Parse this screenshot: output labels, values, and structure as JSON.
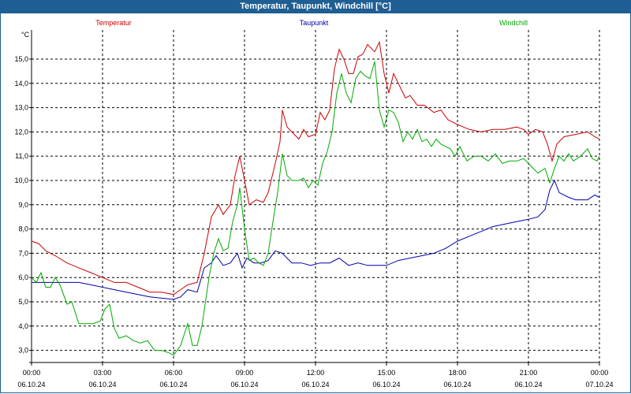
{
  "window": {
    "title": "Temperatur, Taupunkt, Windchill [°C]"
  },
  "chart_data": {
    "type": "line",
    "title": "Temperatur, Taupunkt, Windchill [°C]",
    "ylabel": "°C",
    "xlabel": "",
    "ylim": [
      2.5,
      16.2
    ],
    "xlim": [
      0,
      24
    ],
    "grid": true,
    "y_ticks": [
      "3,0",
      "4,0",
      "5,0",
      "6,0",
      "7,0",
      "8,0",
      "9,0",
      "10,0",
      "11,0",
      "12,0",
      "13,0",
      "14,0",
      "15,0"
    ],
    "y_tick_values": [
      3,
      4,
      5,
      6,
      7,
      8,
      9,
      10,
      11,
      12,
      13,
      14,
      15
    ],
    "x_tick_values": [
      0,
      3,
      6,
      9,
      12,
      15,
      18,
      21,
      24
    ],
    "x_ticks": [
      {
        "time": "00:00",
        "date": "06.10.24"
      },
      {
        "time": "03:00",
        "date": "06.10.24"
      },
      {
        "time": "06:00",
        "date": "06.10.24"
      },
      {
        "time": "09:00",
        "date": "06.10.24"
      },
      {
        "time": "12:00",
        "date": "06.10.24"
      },
      {
        "time": "15:00",
        "date": "06.10.24"
      },
      {
        "time": "18:00",
        "date": "06.10.24"
      },
      {
        "time": "21:00",
        "date": "06.10.24"
      },
      {
        "time": "00:00",
        "date": "07.10.24"
      }
    ],
    "legend": [
      {
        "name": "Temperatur",
        "color": "#cc0000"
      },
      {
        "name": "Taupunkt",
        "color": "#0000aa"
      },
      {
        "name": "Windchill",
        "color": "#00aa00"
      }
    ],
    "series": [
      {
        "name": "Temperatur",
        "color": "#cc0000",
        "points": [
          [
            0,
            7.5
          ],
          [
            0.3,
            7.4
          ],
          [
            0.6,
            7.1
          ],
          [
            1,
            6.9
          ],
          [
            1.5,
            6.6
          ],
          [
            2,
            6.4
          ],
          [
            2.5,
            6.2
          ],
          [
            3,
            6.0
          ],
          [
            3.5,
            5.8
          ],
          [
            4,
            5.8
          ],
          [
            4.5,
            5.6
          ],
          [
            5,
            5.4
          ],
          [
            5.5,
            5.4
          ],
          [
            6,
            5.3
          ],
          [
            6.3,
            5.5
          ],
          [
            6.6,
            5.7
          ],
          [
            7,
            5.8
          ],
          [
            7.3,
            7.0
          ],
          [
            7.6,
            8.5
          ],
          [
            7.9,
            9.0
          ],
          [
            8.1,
            8.6
          ],
          [
            8.4,
            9.0
          ],
          [
            8.6,
            10.2
          ],
          [
            8.8,
            11.0
          ],
          [
            9,
            10.0
          ],
          [
            9.2,
            9.0
          ],
          [
            9.5,
            9.2
          ],
          [
            9.8,
            9.1
          ],
          [
            10,
            9.5
          ],
          [
            10.3,
            10.7
          ],
          [
            10.5,
            11.6
          ],
          [
            10.6,
            12.9
          ],
          [
            10.8,
            12.2
          ],
          [
            11.1,
            11.9
          ],
          [
            11.3,
            11.7
          ],
          [
            11.5,
            12.1
          ],
          [
            11.7,
            11.8
          ],
          [
            12,
            11.9
          ],
          [
            12.2,
            12.8
          ],
          [
            12.4,
            12.5
          ],
          [
            12.6,
            12.9
          ],
          [
            12.8,
            14.6
          ],
          [
            13,
            15.4
          ],
          [
            13.2,
            15.0
          ],
          [
            13.4,
            14.4
          ],
          [
            13.6,
            14.4
          ],
          [
            13.8,
            15.1
          ],
          [
            14,
            15.2
          ],
          [
            14.2,
            15.6
          ],
          [
            14.5,
            15.3
          ],
          [
            14.7,
            15.7
          ],
          [
            14.9,
            14.4
          ],
          [
            15.1,
            13.6
          ],
          [
            15.3,
            14.4
          ],
          [
            15.5,
            14.0
          ],
          [
            15.8,
            13.4
          ],
          [
            16,
            13.5
          ],
          [
            16.3,
            13.1
          ],
          [
            16.6,
            13.1
          ],
          [
            17,
            12.8
          ],
          [
            17.3,
            12.9
          ],
          [
            17.6,
            12.5
          ],
          [
            18,
            12.3
          ],
          [
            18.5,
            12.1
          ],
          [
            19,
            12.0
          ],
          [
            19.5,
            12.1
          ],
          [
            20,
            12.1
          ],
          [
            20.5,
            12.2
          ],
          [
            20.8,
            12.1
          ],
          [
            21,
            11.9
          ],
          [
            21.3,
            12.1
          ],
          [
            21.6,
            12.0
          ],
          [
            21.8,
            11.5
          ],
          [
            22,
            10.8
          ],
          [
            22.2,
            11.5
          ],
          [
            22.5,
            11.8
          ],
          [
            23,
            11.9
          ],
          [
            23.5,
            12.0
          ],
          [
            23.8,
            11.8
          ],
          [
            24,
            11.7
          ]
        ]
      },
      {
        "name": "Taupunkt",
        "color": "#0000aa",
        "points": [
          [
            0,
            5.8
          ],
          [
            0.5,
            5.8
          ],
          [
            1,
            5.8
          ],
          [
            1.5,
            5.8
          ],
          [
            2,
            5.8
          ],
          [
            2.5,
            5.7
          ],
          [
            3,
            5.6
          ],
          [
            3.5,
            5.5
          ],
          [
            4,
            5.4
          ],
          [
            4.5,
            5.3
          ],
          [
            5,
            5.2
          ],
          [
            5.5,
            5.15
          ],
          [
            6,
            5.1
          ],
          [
            6.3,
            5.2
          ],
          [
            6.6,
            5.5
          ],
          [
            7,
            5.4
          ],
          [
            7.3,
            6.4
          ],
          [
            7.6,
            6.6
          ],
          [
            7.8,
            6.9
          ],
          [
            8.1,
            6.5
          ],
          [
            8.4,
            6.6
          ],
          [
            8.7,
            7.0
          ],
          [
            8.9,
            6.4
          ],
          [
            9.1,
            6.8
          ],
          [
            9.4,
            6.6
          ],
          [
            9.7,
            6.6
          ],
          [
            10,
            6.7
          ],
          [
            10.3,
            7.1
          ],
          [
            10.6,
            7.0
          ],
          [
            11,
            6.6
          ],
          [
            11.4,
            6.6
          ],
          [
            11.8,
            6.5
          ],
          [
            12.2,
            6.6
          ],
          [
            12.6,
            6.6
          ],
          [
            13,
            6.8
          ],
          [
            13.4,
            6.5
          ],
          [
            13.8,
            6.6
          ],
          [
            14.2,
            6.5
          ],
          [
            14.6,
            6.5
          ],
          [
            15,
            6.5
          ],
          [
            15.5,
            6.7
          ],
          [
            16,
            6.8
          ],
          [
            16.5,
            6.9
          ],
          [
            17,
            7.0
          ],
          [
            17.5,
            7.2
          ],
          [
            18,
            7.5
          ],
          [
            18.5,
            7.7
          ],
          [
            19,
            7.9
          ],
          [
            19.5,
            8.1
          ],
          [
            20,
            8.2
          ],
          [
            20.5,
            8.3
          ],
          [
            21,
            8.4
          ],
          [
            21.4,
            8.5
          ],
          [
            21.7,
            8.8
          ],
          [
            21.9,
            9.6
          ],
          [
            22.1,
            10.0
          ],
          [
            22.3,
            9.5
          ],
          [
            22.7,
            9.3
          ],
          [
            23,
            9.2
          ],
          [
            23.5,
            9.2
          ],
          [
            23.8,
            9.4
          ],
          [
            24,
            9.3
          ]
        ]
      },
      {
        "name": "Windchill",
        "color": "#00aa00",
        "points": [
          [
            0,
            6.0
          ],
          [
            0.2,
            5.8
          ],
          [
            0.4,
            6.2
          ],
          [
            0.6,
            5.6
          ],
          [
            0.8,
            5.6
          ],
          [
            1,
            6.0
          ],
          [
            1.2,
            5.7
          ],
          [
            1.5,
            4.9
          ],
          [
            1.7,
            5.0
          ],
          [
            2,
            4.1
          ],
          [
            2.3,
            4.1
          ],
          [
            2.6,
            4.1
          ],
          [
            2.9,
            4.2
          ],
          [
            3.1,
            4.7
          ],
          [
            3.3,
            4.9
          ],
          [
            3.5,
            3.9
          ],
          [
            3.7,
            3.5
          ],
          [
            4,
            3.6
          ],
          [
            4.3,
            3.4
          ],
          [
            4.6,
            3.3
          ],
          [
            4.9,
            3.4
          ],
          [
            5.2,
            3.0
          ],
          [
            5.5,
            3.0
          ],
          [
            5.8,
            2.9
          ],
          [
            6,
            2.8
          ],
          [
            6.3,
            3.2
          ],
          [
            6.6,
            4.1
          ],
          [
            6.8,
            3.2
          ],
          [
            7,
            3.2
          ],
          [
            7.2,
            4.0
          ],
          [
            7.5,
            6.0
          ],
          [
            7.7,
            7.0
          ],
          [
            7.9,
            7.6
          ],
          [
            8.1,
            7.1
          ],
          [
            8.3,
            7.2
          ],
          [
            8.5,
            8.3
          ],
          [
            8.7,
            9.0
          ],
          [
            8.8,
            9.7
          ],
          [
            9,
            8.0
          ],
          [
            9.2,
            6.7
          ],
          [
            9.4,
            6.8
          ],
          [
            9.6,
            6.6
          ],
          [
            9.8,
            6.5
          ],
          [
            10,
            7.0
          ],
          [
            10.2,
            8.3
          ],
          [
            10.4,
            9.5
          ],
          [
            10.6,
            11.1
          ],
          [
            10.8,
            10.2
          ],
          [
            11,
            10.0
          ],
          [
            11.3,
            10.0
          ],
          [
            11.5,
            10.1
          ],
          [
            11.7,
            9.7
          ],
          [
            11.9,
            10.0
          ],
          [
            12.1,
            9.8
          ],
          [
            12.3,
            10.7
          ],
          [
            12.5,
            11.2
          ],
          [
            12.7,
            12.0
          ],
          [
            12.9,
            13.6
          ],
          [
            13.1,
            14.4
          ],
          [
            13.3,
            13.6
          ],
          [
            13.5,
            13.2
          ],
          [
            13.7,
            14.2
          ],
          [
            13.9,
            14.5
          ],
          [
            14.1,
            14.3
          ],
          [
            14.3,
            14.2
          ],
          [
            14.5,
            14.9
          ],
          [
            14.7,
            12.9
          ],
          [
            14.9,
            12.2
          ],
          [
            15.1,
            12.9
          ],
          [
            15.3,
            12.8
          ],
          [
            15.5,
            12.4
          ],
          [
            15.7,
            11.6
          ],
          [
            15.9,
            12.0
          ],
          [
            16.1,
            11.7
          ],
          [
            16.3,
            12.1
          ],
          [
            16.5,
            11.6
          ],
          [
            16.7,
            11.7
          ],
          [
            16.9,
            11.4
          ],
          [
            17.1,
            11.7
          ],
          [
            17.3,
            11.5
          ],
          [
            17.5,
            11.4
          ],
          [
            17.7,
            11.3
          ],
          [
            17.9,
            11.0
          ],
          [
            18.1,
            11.4
          ],
          [
            18.4,
            10.8
          ],
          [
            18.7,
            11.0
          ],
          [
            19,
            11.0
          ],
          [
            19.3,
            10.8
          ],
          [
            19.6,
            11.1
          ],
          [
            19.9,
            10.7
          ],
          [
            20.2,
            10.8
          ],
          [
            20.5,
            10.8
          ],
          [
            20.8,
            10.9
          ],
          [
            21.1,
            10.6
          ],
          [
            21.4,
            10.3
          ],
          [
            21.7,
            10.5
          ],
          [
            21.9,
            9.9
          ],
          [
            22.1,
            10.5
          ],
          [
            22.3,
            11.0
          ],
          [
            22.5,
            10.8
          ],
          [
            22.7,
            11.1
          ],
          [
            22.9,
            10.8
          ],
          [
            23.2,
            11.0
          ],
          [
            23.5,
            11.3
          ],
          [
            23.7,
            10.9
          ],
          [
            23.9,
            10.8
          ],
          [
            24,
            11.0
          ]
        ]
      }
    ]
  }
}
